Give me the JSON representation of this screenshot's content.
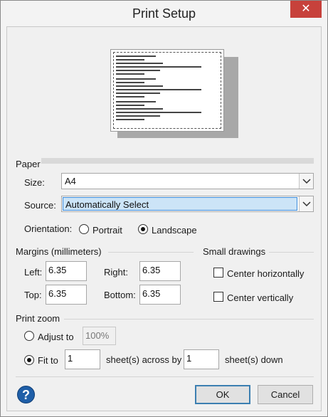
{
  "window": {
    "title": "Print Setup",
    "close_glyph": "✕"
  },
  "paper": {
    "section_label": "Paper",
    "size_label": "Size:",
    "size_value": "A4",
    "source_label": "Source:",
    "source_value": "Automatically Select",
    "orientation_label": "Orientation:",
    "portrait_label": "Portrait",
    "landscape_label": "Landscape",
    "orientation_selected": "Landscape"
  },
  "margins": {
    "section_label": "Margins (millimeters)",
    "left_label": "Left:",
    "left_value": "6.35",
    "right_label": "Right:",
    "right_value": "6.35",
    "top_label": "Top:",
    "top_value": "6.35",
    "bottom_label": "Bottom:",
    "bottom_value": "6.35"
  },
  "small_drawings": {
    "section_label": "Small drawings",
    "center_horizontally_label": "Center horizontally",
    "center_vertically_label": "Center vertically"
  },
  "print_zoom": {
    "section_label": "Print zoom",
    "adjust_to_label": "Adjust to",
    "adjust_to_value": "100%",
    "fit_to_label": "Fit to",
    "fit_across_value": "1",
    "across_label": "sheet(s) across by",
    "fit_down_value": "1",
    "down_label": "sheet(s) down",
    "selected": "Fit to"
  },
  "buttons": {
    "help_glyph": "?",
    "ok": "OK",
    "cancel": "Cancel"
  },
  "icons": {
    "close": "close-icon",
    "dropdown": "chevron-down-icon",
    "help": "help-icon"
  },
  "colors": {
    "close_button": "#c7413b",
    "selection": "#cce4f7",
    "help": "#1f5fa8"
  }
}
